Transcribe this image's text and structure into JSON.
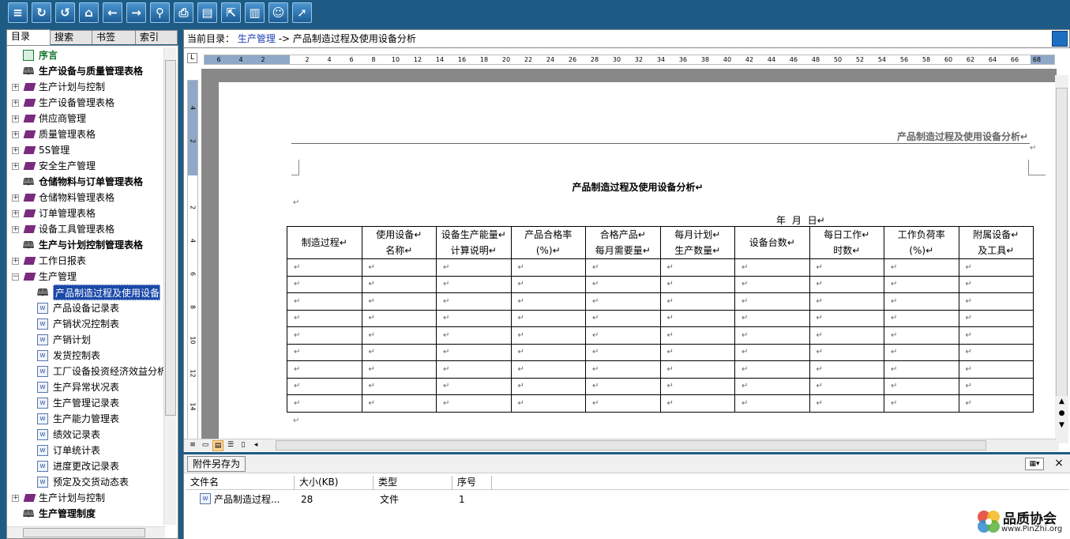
{
  "toolbar": {
    "buttons": [
      {
        "name": "directory-icon",
        "glyph": "≡"
      },
      {
        "name": "refresh-icon",
        "glyph": "↻"
      },
      {
        "name": "undo-icon",
        "glyph": "↺"
      },
      {
        "name": "home-icon",
        "glyph": "⌂"
      },
      {
        "name": "back-icon",
        "glyph": "←"
      },
      {
        "name": "forward-icon",
        "glyph": "→"
      },
      {
        "name": "search-icon",
        "glyph": "⚲"
      },
      {
        "name": "print-icon",
        "glyph": "⎙"
      },
      {
        "name": "notes-icon",
        "glyph": "▤"
      },
      {
        "name": "export-icon",
        "glyph": "⇱"
      },
      {
        "name": "bookmark-icon",
        "glyph": "▥"
      },
      {
        "name": "smiley-icon",
        "glyph": "☺"
      },
      {
        "name": "pointer-icon",
        "glyph": "➚"
      }
    ]
  },
  "left_tabs": [
    "目录",
    "搜索",
    "书签",
    "索引"
  ],
  "tree": [
    {
      "label": "序言",
      "icon": "preface",
      "level": 0,
      "expander": "",
      "bold": true,
      "color": "#1a7a35"
    },
    {
      "label": "生产设备与质量管理表格",
      "icon": "open",
      "level": 0,
      "expander": "",
      "bold": true
    },
    {
      "label": "生产计划与控制",
      "icon": "book",
      "level": 0,
      "expander": "+"
    },
    {
      "label": "生产设备管理表格",
      "icon": "book",
      "level": 0,
      "expander": "+"
    },
    {
      "label": "供应商管理",
      "icon": "book",
      "level": 0,
      "expander": "+"
    },
    {
      "label": "质量管理表格",
      "icon": "book",
      "level": 0,
      "expander": "+"
    },
    {
      "label": "5S管理",
      "icon": "book",
      "level": 0,
      "expander": "+"
    },
    {
      "label": "安全生产管理",
      "icon": "book",
      "level": 0,
      "expander": "+"
    },
    {
      "label": "仓储物料与订单管理表格",
      "icon": "open",
      "level": 0,
      "expander": "",
      "bold": true
    },
    {
      "label": "仓储物料管理表格",
      "icon": "book",
      "level": 0,
      "expander": "+"
    },
    {
      "label": "订单管理表格",
      "icon": "book",
      "level": 0,
      "expander": "+"
    },
    {
      "label": "设备工具管理表格",
      "icon": "book",
      "level": 0,
      "expander": "+"
    },
    {
      "label": "生产与计划控制管理表格",
      "icon": "open",
      "level": 0,
      "expander": "",
      "bold": true
    },
    {
      "label": "工作日报表",
      "icon": "book",
      "level": 0,
      "expander": "+"
    },
    {
      "label": "生产管理",
      "icon": "book",
      "level": 0,
      "expander": "−"
    },
    {
      "label": "产品制造过程及使用设备分析",
      "icon": "open-doc",
      "level": 1,
      "expander": "",
      "selected": true
    },
    {
      "label": "产品设备记录表",
      "icon": "doc",
      "level": 1,
      "expander": ""
    },
    {
      "label": "产销状况控制表",
      "icon": "doc",
      "level": 1,
      "expander": ""
    },
    {
      "label": "产销计划",
      "icon": "doc",
      "level": 1,
      "expander": ""
    },
    {
      "label": "发货控制表",
      "icon": "doc",
      "level": 1,
      "expander": ""
    },
    {
      "label": "工厂设备投资经济效益分析",
      "icon": "doc",
      "level": 1,
      "expander": ""
    },
    {
      "label": "生产异常状况表",
      "icon": "doc",
      "level": 1,
      "expander": ""
    },
    {
      "label": "生产管理记录表",
      "icon": "doc",
      "level": 1,
      "expander": ""
    },
    {
      "label": "生产能力管理表",
      "icon": "doc",
      "level": 1,
      "expander": ""
    },
    {
      "label": "绩效记录表",
      "icon": "doc",
      "level": 1,
      "expander": ""
    },
    {
      "label": "订单统计表",
      "icon": "doc",
      "level": 1,
      "expander": ""
    },
    {
      "label": "进度更改记录表",
      "icon": "doc",
      "level": 1,
      "expander": ""
    },
    {
      "label": "预定及交货动态表",
      "icon": "doc",
      "level": 1,
      "expander": ""
    },
    {
      "label": "生产计划与控制",
      "icon": "book",
      "level": 0,
      "expander": "+"
    },
    {
      "label": "生产管理制度",
      "icon": "open",
      "level": 0,
      "expander": "",
      "bold": true
    }
  ],
  "breadcrumb": {
    "prefix": "当前目录：",
    "link": "生产管理",
    "arrow": "->",
    "current": "产品制造过程及使用设备分析"
  },
  "ruler": {
    "h_ticks": [
      "6",
      "4",
      "2",
      "",
      "2",
      "4",
      "6",
      "8",
      "10",
      "12",
      "14",
      "16",
      "18",
      "20",
      "22",
      "24",
      "26",
      "28",
      "30",
      "32",
      "34",
      "36",
      "38",
      "40",
      "42",
      "44",
      "46",
      "48",
      "50",
      "52",
      "54",
      "56",
      "58",
      "60",
      "62",
      "64",
      "66",
      "68"
    ],
    "v_ticks": [
      "4",
      "2",
      "",
      "2",
      "4",
      "6",
      "8",
      "10",
      "12",
      "14"
    ]
  },
  "document": {
    "header": "产品制造过程及使用设备分析↵",
    "header_mark": "↵",
    "title": "产品制造过程及使用设备分析↵",
    "para_mark": "↵",
    "date_line": "年  月  日↵",
    "columns": [
      "制造过程↵",
      "使用设备↵ 名称↵",
      "设备生产能量↵ 计算说明↵",
      "产品合格率(%)↵",
      "合格产品↵ 每月需要量↵",
      "每月计划↵ 生产数量↵",
      "设备台数↵",
      "每日工作↵ 时数↵",
      "工作负荷率(%)↵",
      "附属设备↵ 及工具↵"
    ],
    "row_count": 9,
    "cell_mark": "↵",
    "end_mark": "↵"
  },
  "attachments": {
    "save_button": "附件另存为",
    "columns": [
      "文件名",
      "大小(KB)",
      "类型",
      "序号"
    ],
    "rows": [
      {
        "name": "产品制造过程...",
        "size": "28",
        "type": "文件",
        "index": "1"
      }
    ]
  },
  "logo": {
    "cn": "品质协会",
    "url": "www.PinZhi.org"
  }
}
